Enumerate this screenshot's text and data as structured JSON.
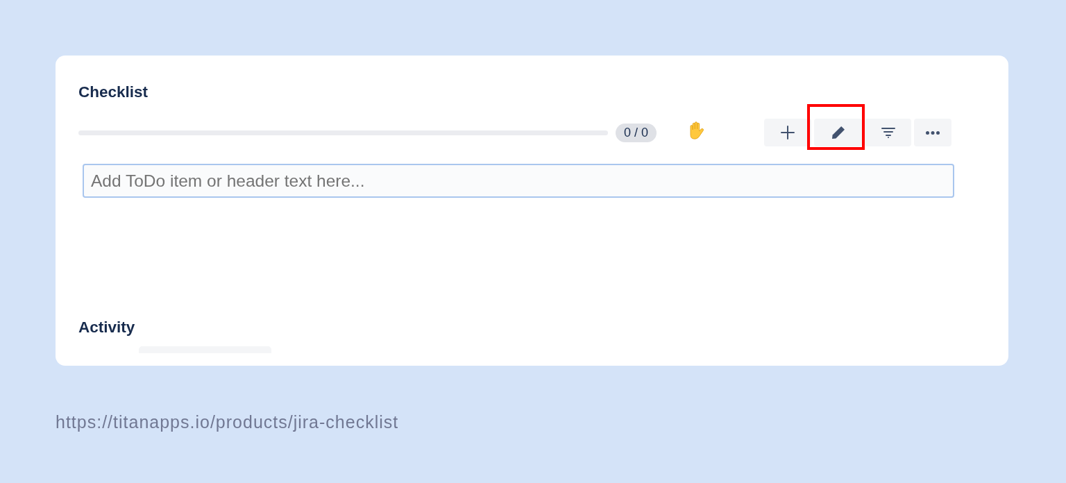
{
  "checklist": {
    "title": "Checklist",
    "count_badge": "0 / 0",
    "toolbar": [
      {
        "kind": "add",
        "highlighted": false
      },
      {
        "kind": "edit",
        "highlighted": true
      },
      {
        "kind": "filter",
        "highlighted": false
      },
      {
        "kind": "more",
        "highlighted": false
      }
    ],
    "input": {
      "placeholder": "Add ToDo item or header text here...",
      "focused": true
    }
  },
  "activity": {
    "title": "Activity"
  },
  "source_url": "https://titanapps.io/products/jira-checklist"
}
